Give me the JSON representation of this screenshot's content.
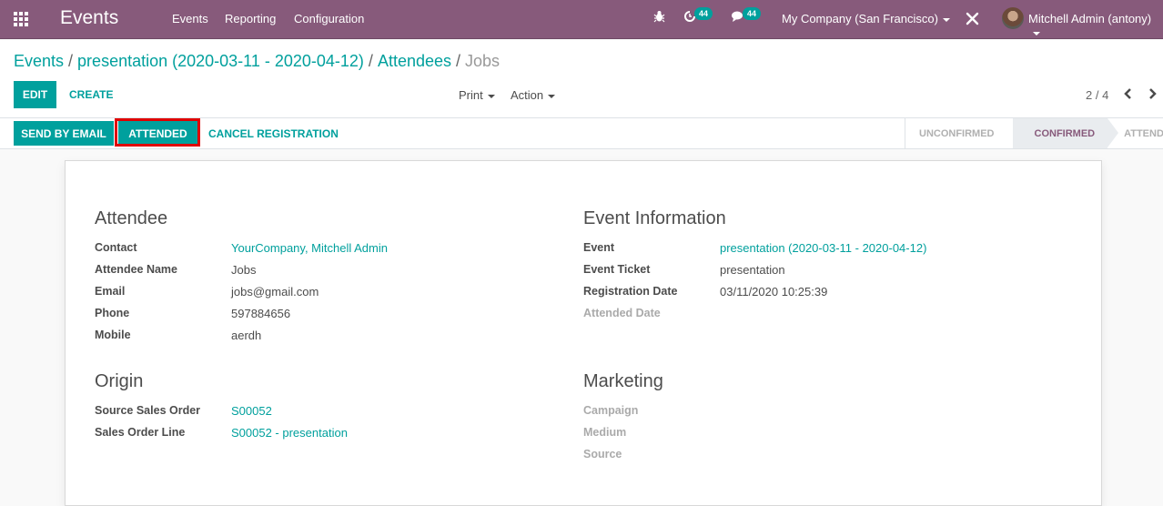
{
  "navbar": {
    "app_name": "Events",
    "menu": [
      "Events",
      "Reporting",
      "Configuration"
    ],
    "activity_count": "44",
    "messages_count": "44",
    "company": "My Company (San Francisco)",
    "user": "Mitchell Admin (antony)",
    "icons": {
      "apps": "apps-grid-icon",
      "debug": "bug-icon",
      "activity": "clock-icon",
      "messages": "chat-icon",
      "tools": "tools-icon"
    }
  },
  "breadcrumb": {
    "items": [
      "Events",
      "presentation (2020-03-11 - 2020-04-12)",
      "Attendees"
    ],
    "current": "Jobs",
    "separator": "/"
  },
  "toolbar": {
    "edit_label": "EDIT",
    "create_label": "CREATE",
    "print_label": "Print",
    "action_label": "Action",
    "pager": "2 / 4"
  },
  "statusbar": {
    "buttons": [
      "SEND BY EMAIL",
      "ATTENDED",
      "CANCEL REGISTRATION"
    ],
    "stages": [
      "UNCONFIRMED",
      "CONFIRMED",
      "ATTENDED"
    ],
    "current_stage": "CONFIRMED"
  },
  "form": {
    "attendee": {
      "title": "Attendee",
      "fields": [
        {
          "label": "Contact",
          "value": "YourCompany, Mitchell Admin"
        },
        {
          "label": "Attendee Name",
          "value": "Jobs"
        },
        {
          "label": "Email",
          "value": "jobs@gmail.com"
        },
        {
          "label": "Phone",
          "value": "597884656"
        },
        {
          "label": "Mobile",
          "value": "aerdh"
        }
      ]
    },
    "event_info": {
      "title": "Event Information",
      "fields": [
        {
          "label": "Event",
          "value": "presentation (2020-03-11 - 2020-04-12)"
        },
        {
          "label": "Event Ticket",
          "value": "presentation"
        },
        {
          "label": "Registration Date",
          "value": "03/11/2020 10:25:39"
        },
        {
          "label": "Attended Date",
          "value": ""
        }
      ]
    },
    "origin": {
      "title": "Origin",
      "fields": [
        {
          "label": "Source Sales Order",
          "value": "S00052"
        },
        {
          "label": "Sales Order Line",
          "value": "S00052 - presentation"
        }
      ]
    },
    "marketing": {
      "title": "Marketing",
      "fields": [
        {
          "label": "Campaign",
          "value": ""
        },
        {
          "label": "Medium",
          "value": ""
        },
        {
          "label": "Source",
          "value": ""
        }
      ]
    }
  },
  "colors": {
    "brand": "#875a7b",
    "accent": "#00a09d",
    "highlight": "#e00000"
  }
}
